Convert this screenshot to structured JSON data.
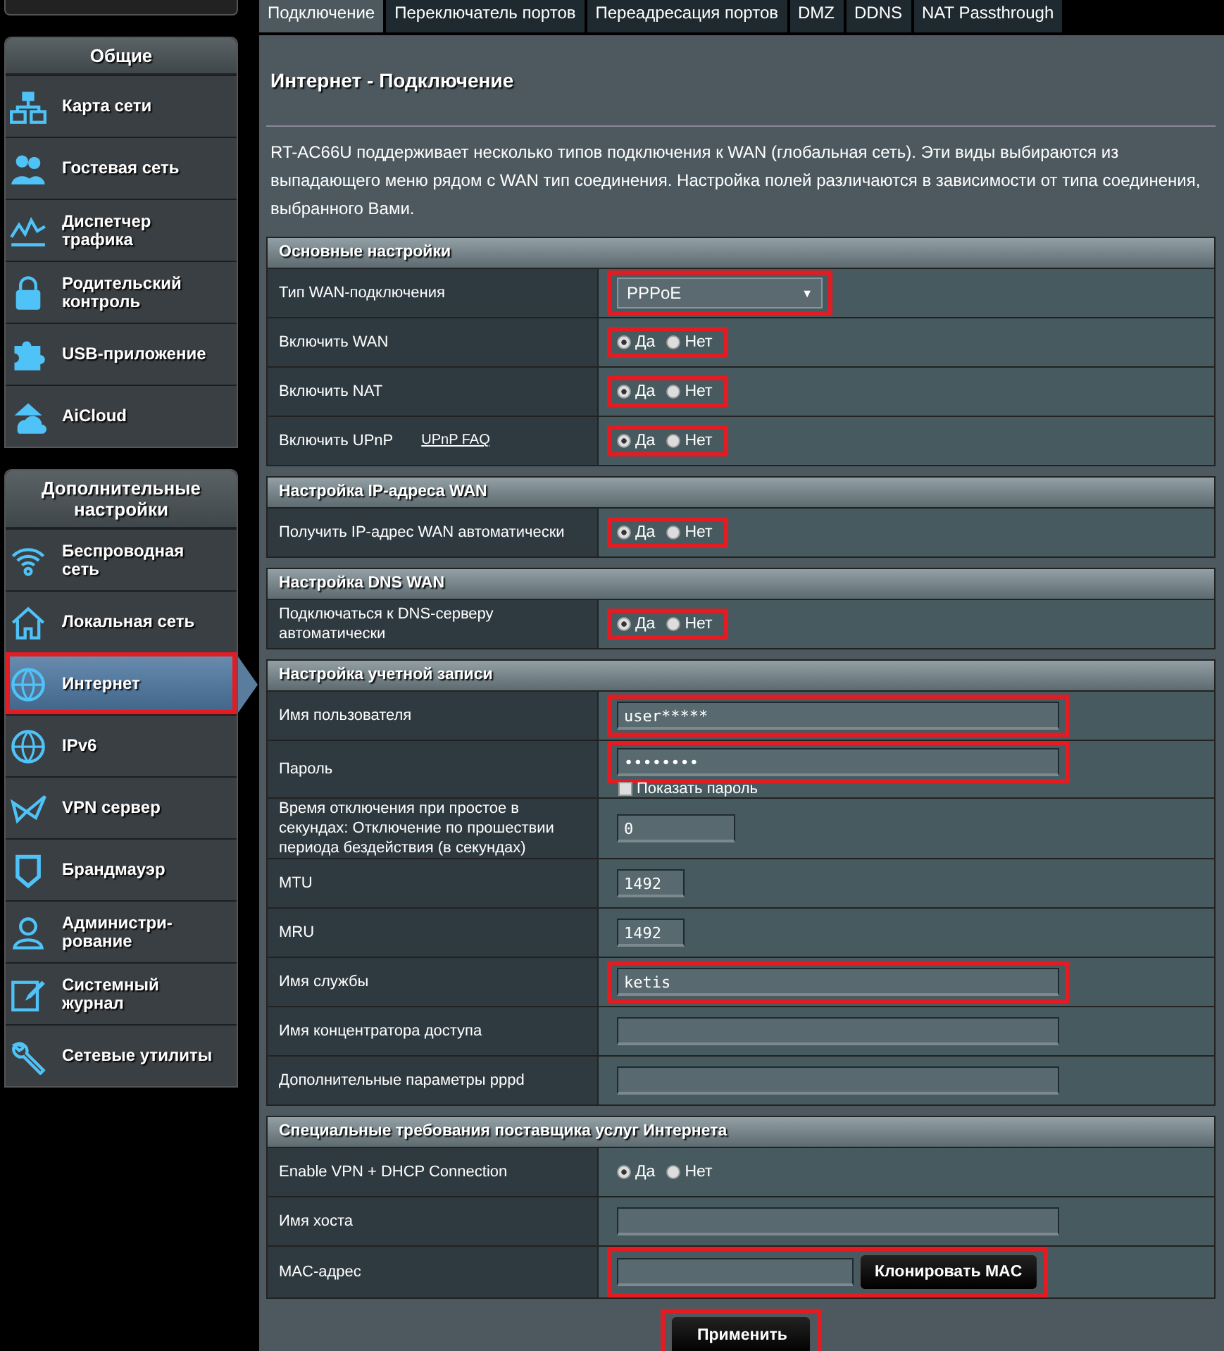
{
  "sidebar": {
    "sections": [
      {
        "title": "Общие",
        "items": [
          {
            "label": "Карта сети",
            "selected": false,
            "marked": false
          },
          {
            "label": "Гостевая сеть",
            "selected": false,
            "marked": false
          },
          {
            "label": "Диспетчер трафика",
            "selected": false,
            "marked": false
          },
          {
            "label": "Родительский контроль",
            "selected": false,
            "marked": false
          },
          {
            "label": "USB-приложение",
            "selected": false,
            "marked": false
          },
          {
            "label": "AiCloud",
            "selected": false,
            "marked": false
          }
        ]
      },
      {
        "title": "Дополнительные настройки",
        "items": [
          {
            "label": "Беспроводная сеть",
            "selected": false,
            "marked": false
          },
          {
            "label": "Локальная сеть",
            "selected": false,
            "marked": false
          },
          {
            "label": "Интернет",
            "selected": true,
            "marked": true
          },
          {
            "label": "IPv6",
            "selected": false,
            "marked": false
          },
          {
            "label": "VPN сервер",
            "selected": false,
            "marked": false
          },
          {
            "label": "Брандмауэр",
            "selected": false,
            "marked": false
          },
          {
            "label": "Администри-рование",
            "selected": false,
            "marked": false
          },
          {
            "label": "Системный журнал",
            "selected": false,
            "marked": false
          },
          {
            "label": "Сетевые утилиты",
            "selected": false,
            "marked": false
          }
        ]
      }
    ]
  },
  "tabs": [
    {
      "label": "Подключение",
      "selected": true
    },
    {
      "label": "Переключатель портов",
      "selected": false
    },
    {
      "label": "Переадресация портов",
      "selected": false
    },
    {
      "label": "DMZ",
      "selected": false
    },
    {
      "label": "DDNS",
      "selected": false
    },
    {
      "label": "NAT Passthrough",
      "selected": false
    }
  ],
  "page": {
    "title": "Интернет - Подключение",
    "description": "RT-AC66U поддерживает несколько типов подключения к WAN (глобальная сеть). Эти виды выбираются из выпадающего меню рядом с WAN тип соединения. Настройка полей различаются в зависимости от типа соединения, выбранного Вами."
  },
  "sections": [
    {
      "title": "Основные настройки",
      "rows": [
        {
          "kind": "select",
          "label": "Тип WAN-подключения",
          "value": "PPPoE",
          "arrow": "▼",
          "marked": true
        },
        {
          "kind": "radio",
          "label": "Включить WAN",
          "marked": true,
          "options": [
            {
              "label": "Да",
              "selected": true
            },
            {
              "label": "Нет",
              "selected": false
            }
          ]
        },
        {
          "kind": "radio",
          "label": "Включить NAT",
          "marked": true,
          "options": [
            {
              "label": "Да",
              "selected": true
            },
            {
              "label": "Нет",
              "selected": false
            }
          ]
        },
        {
          "kind": "radio",
          "label": "Включить UPnP",
          "link": "UPnP  FAQ",
          "marked": true,
          "options": [
            {
              "label": "Да",
              "selected": true
            },
            {
              "label": "Нет",
              "selected": false
            }
          ]
        }
      ]
    },
    {
      "title": "Настройка IP-адреса WAN",
      "rows": [
        {
          "kind": "radio",
          "label": "Получить IP-адрес WAN автоматически",
          "marked": true,
          "options": [
            {
              "label": "Да",
              "selected": true
            },
            {
              "label": "Нет",
              "selected": false
            }
          ]
        }
      ]
    },
    {
      "title": "Настройка DNS WAN",
      "rows": [
        {
          "kind": "radio",
          "label": "Подключаться к DNS-серверу автоматически",
          "marked": true,
          "options": [
            {
              "label": "Да",
              "selected": true
            },
            {
              "label": "Нет",
              "selected": false
            }
          ]
        }
      ]
    },
    {
      "title": "Настройка учетной записи",
      "rows": [
        {
          "kind": "text",
          "label": "Имя пользователя",
          "value": "user*****",
          "marked": true
        },
        {
          "kind": "password",
          "label": "Пароль",
          "value": "••••••••",
          "marked": true,
          "show_password": {
            "label": "Показать пароль",
            "checked": false
          }
        },
        {
          "kind": "short",
          "label": "Время отключения при простое в секундах: Отключение по прошествии периода бездействия (в секундах)",
          "value": "0",
          "marked": false
        },
        {
          "kind": "tiny",
          "label": "MTU",
          "value": "1492",
          "marked": false
        },
        {
          "kind": "tiny",
          "label": "MRU",
          "value": "1492",
          "marked": false
        },
        {
          "kind": "text",
          "label": "Имя службы",
          "value": "ketis",
          "marked": true
        },
        {
          "kind": "text",
          "label": "Имя концентратора доступа",
          "marked": false
        },
        {
          "kind": "text",
          "label": "Дополнительные параметры pppd",
          "marked": false
        }
      ]
    },
    {
      "title": "Специальные требования поставщика услуг Интернета",
      "rows": [
        {
          "kind": "radio",
          "label": "Enable VPN + DHCP Connection",
          "marked": false,
          "options": [
            {
              "label": "Да",
              "selected": true
            },
            {
              "label": "Нет",
              "selected": false
            }
          ]
        },
        {
          "kind": "text",
          "label": "Имя хоста",
          "marked": false
        },
        {
          "kind": "mac",
          "label": "MAC-адрес",
          "button": "Клонировать MAC",
          "marked": true
        }
      ]
    }
  ],
  "apply": {
    "label": "Применить",
    "marked": true
  }
}
